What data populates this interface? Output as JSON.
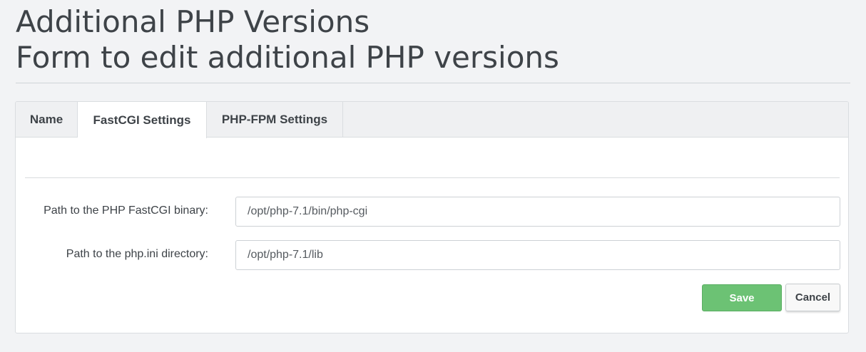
{
  "header": {
    "title": "Additional PHP Versions",
    "subtitle": "Form to edit additional PHP versions"
  },
  "tabs": [
    {
      "label": "Name",
      "active": false
    },
    {
      "label": "FastCGI Settings",
      "active": true
    },
    {
      "label": "PHP-FPM Settings",
      "active": false
    }
  ],
  "form": {
    "fastcgi_binary": {
      "label": "Path to the PHP FastCGI binary:",
      "value": "/opt/php-7.1/bin/php-cgi"
    },
    "ini_directory": {
      "label": "Path to the php.ini directory:",
      "value": "/opt/php-7.1/lib"
    }
  },
  "buttons": {
    "save_label": "Save",
    "cancel_label": "Cancel"
  },
  "colors": {
    "save_button": "#6cc274",
    "page_background": "#f2f3f5",
    "text": "#3e4348"
  }
}
